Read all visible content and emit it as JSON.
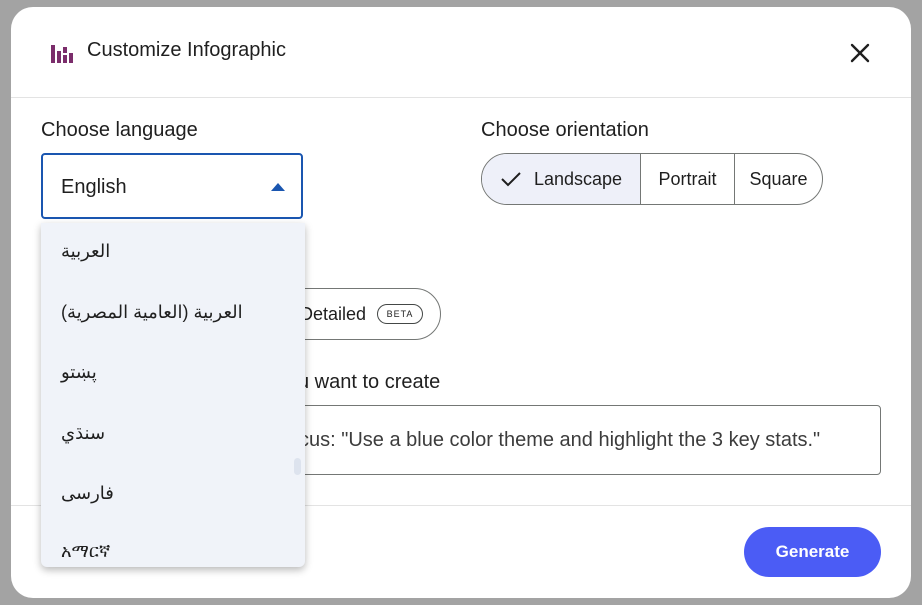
{
  "dialog": {
    "title": "Customize Infographic",
    "header_icon": "infographic-bars-icon",
    "close_icon": "close-icon"
  },
  "language": {
    "label": "Choose language",
    "selected": "English",
    "options": [
      "العربية",
      "العربية (العامية المصرية)",
      "پښتو",
      "سنڌي",
      "فارسی",
      "አማርኛ"
    ]
  },
  "orientation": {
    "label": "Choose orientation",
    "options": [
      "Landscape",
      "Portrait",
      "Square"
    ],
    "selected": "Landscape"
  },
  "detail": {
    "option_label": "Detailed",
    "badge": "BETA"
  },
  "prompt": {
    "label": "u want to create",
    "text": "cus: \"Use a blue color theme and highlight the 3 key stats.\""
  },
  "footer": {
    "generate_label": "Generate"
  },
  "colors": {
    "accent": "#4b5cf5",
    "select_border": "#1a56b0",
    "icon_brand": "#7b2d6b"
  }
}
